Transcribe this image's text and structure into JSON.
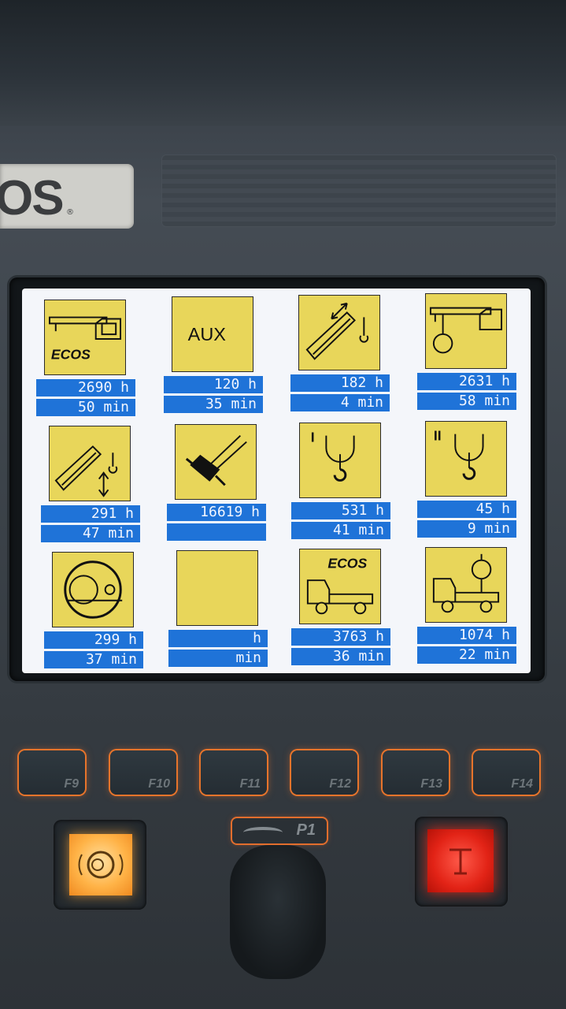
{
  "brand": {
    "logo_text": "OS",
    "reg_mark": "®"
  },
  "tiles": [
    {
      "icon": "crane-ecos-icon",
      "hours": "2690 h",
      "minutes": "50 min",
      "ecos_label": "ECOS"
    },
    {
      "icon": "aux-icon",
      "hours": "120 h",
      "minutes": "35 min",
      "aux_label": "AUX"
    },
    {
      "icon": "boom-telescope-icon",
      "hours": "182 h",
      "minutes": "4 min"
    },
    {
      "icon": "crane-hook-icon",
      "hours": "2631 h",
      "minutes": "58 min"
    },
    {
      "icon": "boom-luffing-icon",
      "hours": "291 h",
      "minutes": "47 min"
    },
    {
      "icon": "hydraulic-cylinder-icon",
      "hours": "16619 h",
      "minutes": ""
    },
    {
      "icon": "hoist-1-icon",
      "hours": "531 h",
      "minutes": "41 min",
      "roman": "I"
    },
    {
      "icon": "hoist-2-icon",
      "hours": "45 h",
      "minutes": "9 min",
      "roman": "II"
    },
    {
      "icon": "slewing-icon",
      "hours": "299 h",
      "minutes": "37 min"
    },
    {
      "icon": "blank-icon",
      "hours": "h",
      "minutes": "min"
    },
    {
      "icon": "truck-ecos-icon",
      "hours": "3763 h",
      "minutes": "36 min",
      "ecos_label": "ECOS"
    },
    {
      "icon": "truck-crane-icon",
      "hours": "1074 h",
      "minutes": "22 min"
    }
  ],
  "function_keys": [
    "F9",
    "F10",
    "F11",
    "F12",
    "F13",
    "F14"
  ],
  "p1_label": "P1",
  "colors": {
    "tile_bg": "#e8d65a",
    "bar_bg": "#1f73d8",
    "key_glow": "#e7742b",
    "stop_red": "#e22316"
  }
}
